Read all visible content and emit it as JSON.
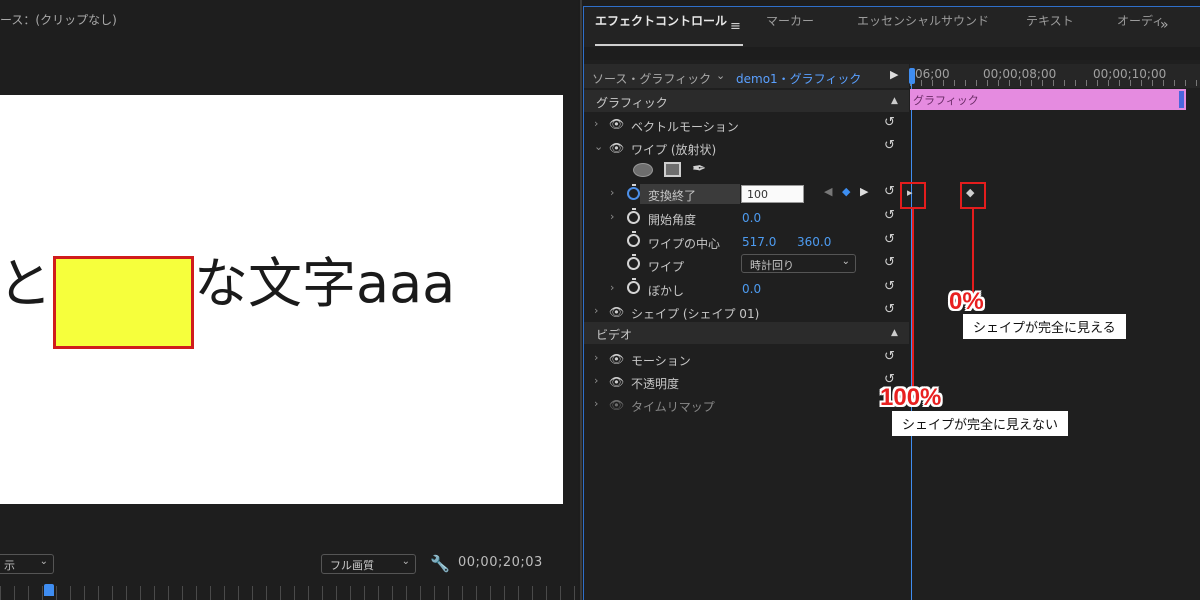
{
  "program_monitor": {
    "source_label": "ース：(クリップなし)",
    "canvas_text_before": "と",
    "canvas_text_after": "な文字aaa",
    "display_select": "示",
    "quality_select": "フル画質",
    "timecode": "00;00;20;03"
  },
  "tabs": [
    {
      "label": "エフェクトコントロール"
    },
    {
      "label": "マーカー"
    },
    {
      "label": "エッセンシャルサウンド"
    },
    {
      "label": "テキスト"
    },
    {
      "label": "オーディ"
    }
  ],
  "header": {
    "source": "ソース・グラフィック",
    "clip": "demo1・グラフィック"
  },
  "ruler": {
    "labels": [
      "06;00",
      "00;00;08;00",
      "00;00;10;00"
    ]
  },
  "clip_bar_label": "グラフィック",
  "sections": {
    "graphic": "グラフィック",
    "video": "ビデオ"
  },
  "effects": {
    "vector_motion": "ベクトルモーション",
    "wipe": "ワイプ (放射状)",
    "transition_end": {
      "label": "変換終了",
      "value": "100"
    },
    "start_angle": {
      "label": "開始角度",
      "value": "0.0"
    },
    "wipe_center": {
      "label": "ワイプの中心",
      "x": "517.0",
      "y": "360.0"
    },
    "wipe_dir": {
      "label": "ワイプ",
      "value": "時計回り"
    },
    "feather": {
      "label": "ぼかし",
      "value": "0.0"
    },
    "shape": "シェイプ (シェイプ 01)",
    "motion": "モーション",
    "opacity": "不透明度",
    "time_remap": "タイムリマップ"
  },
  "annotations": {
    "pct_100": "100%",
    "note_100": "シェイプが完全に見えない",
    "pct_0": "0%",
    "note_0": "シェイプが完全に見える"
  },
  "colors": {
    "accent_blue": "#3f8df1",
    "clip_pink": "#e58be0",
    "annotation_red": "#e41d1d",
    "highlight_yellow": "#f6ff3c"
  }
}
